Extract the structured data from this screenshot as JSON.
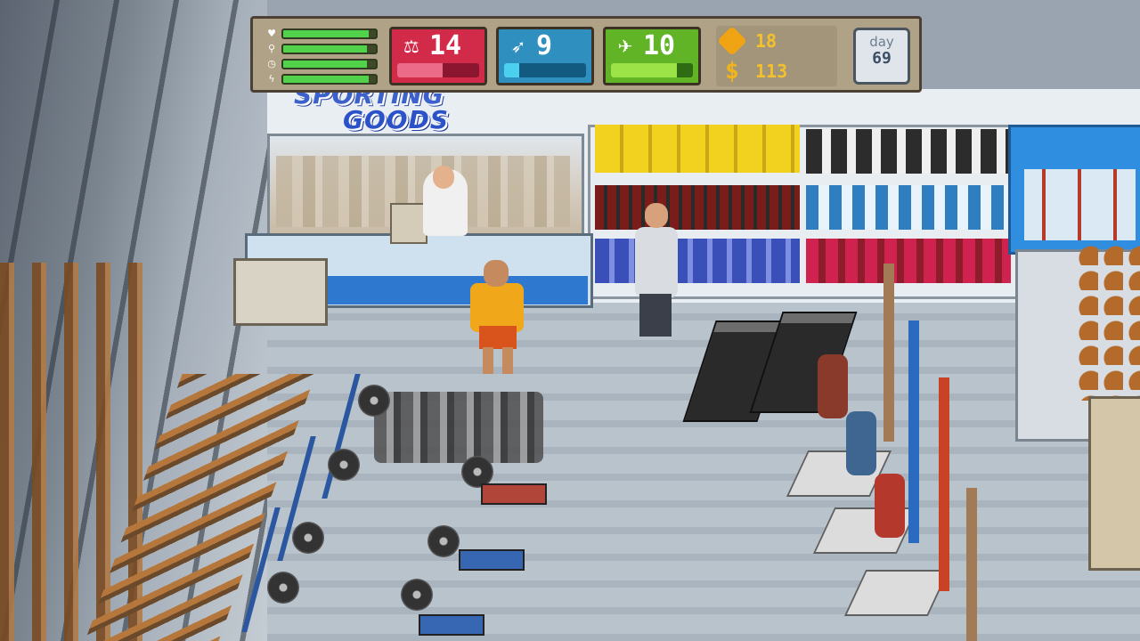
{
  "store": {
    "sign_line1": "SPORTING",
    "sign_line2": "GOODS"
  },
  "hud": {
    "needs": [
      {
        "icon": "heart-icon",
        "level": 0.92
      },
      {
        "icon": "drumstick-icon",
        "level": 0.9
      },
      {
        "icon": "clock-icon",
        "level": 0.9
      },
      {
        "icon": "lightning-icon",
        "level": 0.92
      }
    ],
    "stats": {
      "strength": {
        "value": "14",
        "progress": 0.55,
        "icon": "kettlebell-icon",
        "color": "#d22b4a"
      },
      "agility": {
        "value": "9",
        "progress": 0.18,
        "icon": "runner-icon",
        "color": "#2f8fbf"
      },
      "stamina": {
        "value": "10",
        "progress": 0.8,
        "icon": "running-shoe-icon",
        "color": "#61b426"
      }
    },
    "tokens": "18",
    "money": "113",
    "day_label": "day",
    "day_value": "69"
  }
}
